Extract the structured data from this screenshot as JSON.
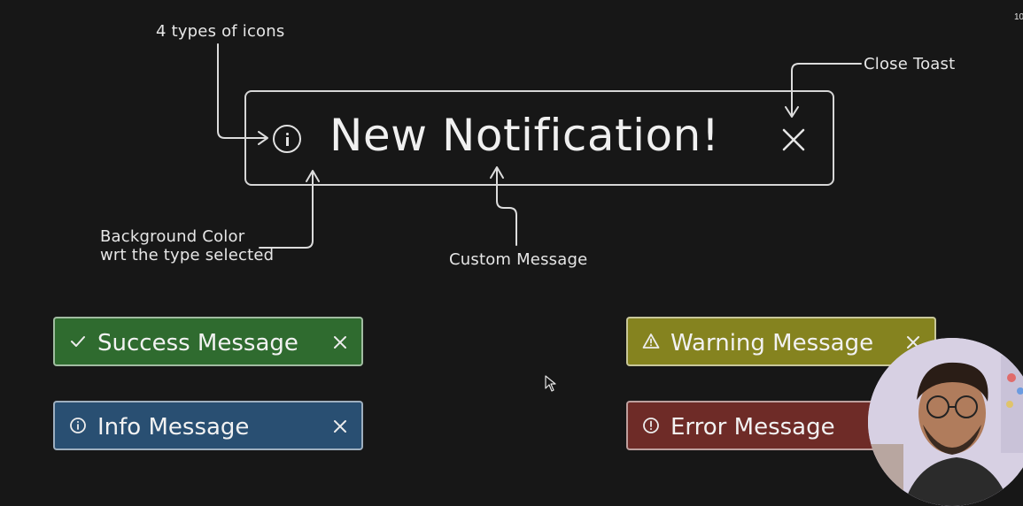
{
  "annotations": {
    "icons_label": "4 types of icons",
    "close_label": "Close Toast",
    "bg_line1": "Background Color",
    "bg_line2": "wrt the type selected",
    "custom_label": "Custom Message"
  },
  "main_toast": {
    "message": "New Notification!",
    "icon": "info-icon"
  },
  "toasts": {
    "success": {
      "label": "Success Message",
      "icon": "check-icon",
      "color": "#2f6b2f"
    },
    "info": {
      "label": "Info Message",
      "icon": "info-icon",
      "color": "#294f72"
    },
    "warning": {
      "label": "Warning Message",
      "icon": "warning-icon",
      "color": "#85831f"
    },
    "error": {
      "label": "Error Message",
      "icon": "error-icon",
      "color": "#6e2b27"
    }
  },
  "corner_text": "10"
}
